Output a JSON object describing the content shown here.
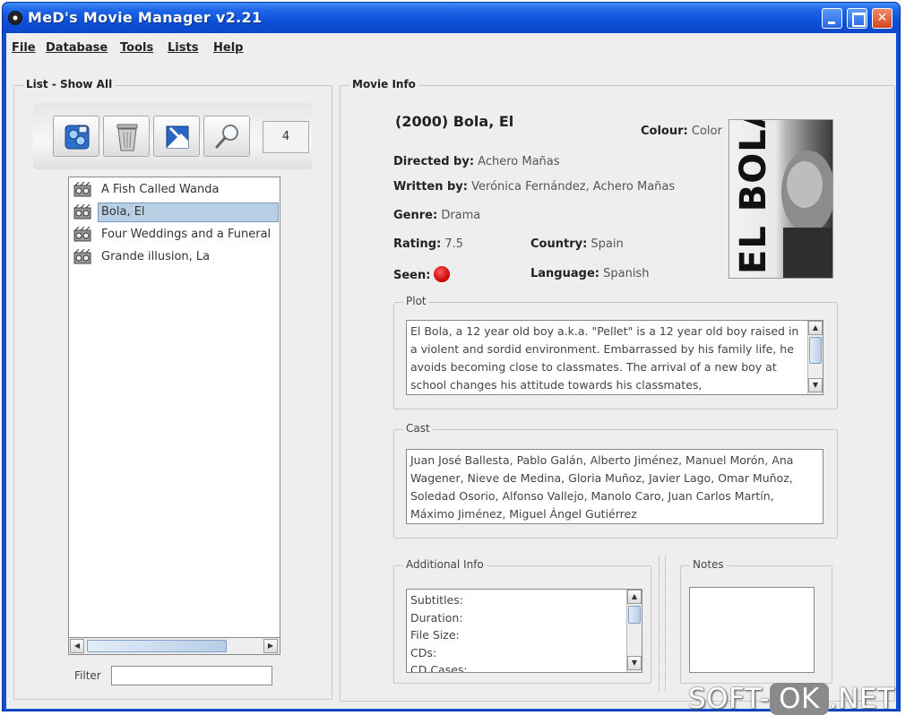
{
  "window": {
    "title": "MeD's Movie Manager v2.21"
  },
  "menu": [
    "File",
    "Database",
    "Tools",
    "Lists",
    "Help"
  ],
  "left_panel": {
    "title": "List - Show All",
    "toolbar": {
      "buttons": [
        "add-movie-icon",
        "delete-trash-icon",
        "edit-image-icon",
        "search-magnifier-icon"
      ],
      "count": "4"
    },
    "movies": [
      {
        "title": "A Fish Called Wanda",
        "selected": false
      },
      {
        "title": "Bola, El",
        "selected": true
      },
      {
        "title": "Four Weddings and a Funeral",
        "selected": false
      },
      {
        "title": "Grande illusion, La",
        "selected": false
      }
    ],
    "filter": {
      "label": "Filter",
      "value": ""
    }
  },
  "movie_info": {
    "panel_title": "Movie Info",
    "title": "(2000) Bola, El",
    "colour_label": "Colour:",
    "colour": "Color",
    "directed_label": "Directed by:",
    "directed": "Achero Mañas",
    "written_label": "Written by:",
    "written": "Verónica Fernández, Achero Mañas",
    "genre_label": "Genre:",
    "genre": "Drama",
    "rating_label": "Rating:",
    "rating": "7.5",
    "country_label": "Country:",
    "country": "Spain",
    "seen_label": "Seen:",
    "language_label": "Language:",
    "language": "Spanish",
    "poster_text": "EL BOLA",
    "plot_title": "Plot",
    "plot": "El Bola, a 12 year old boy a.k.a. \"Pellet\" is a 12 year old boy raised in a violent and sordid environment. Embarrassed by his family life, he avoids becoming close to classmates. The arrival of a new boy at school changes his attitude towards his classmates,",
    "cast_title": "Cast",
    "cast": "Juan José Ballesta, Pablo Galán, Alberto Jiménez, Manuel Morón, Ana Wagener, Nieve de Medina, Gloria Muñoz, Javier Lago, Omar Muñoz, Soledad Osorio, Alfonso Vallejo, Manolo Caro, Juan Carlos Martín, Máximo Jiménez, Miguel Ángel Gutiérrez",
    "additional_title": "Additional Info",
    "additional": [
      "Subtitles:",
      "Duration:",
      "File Size:",
      "CDs:",
      "CD Cases:"
    ],
    "notes_title": "Notes",
    "notes": ""
  },
  "watermark": {
    "left": "SOFT-",
    "middle": "OK",
    "right": ".NET"
  },
  "colors": {
    "titlebar": "#0b47c9",
    "selection": "#b8cfe5",
    "seen": "#c30000"
  }
}
